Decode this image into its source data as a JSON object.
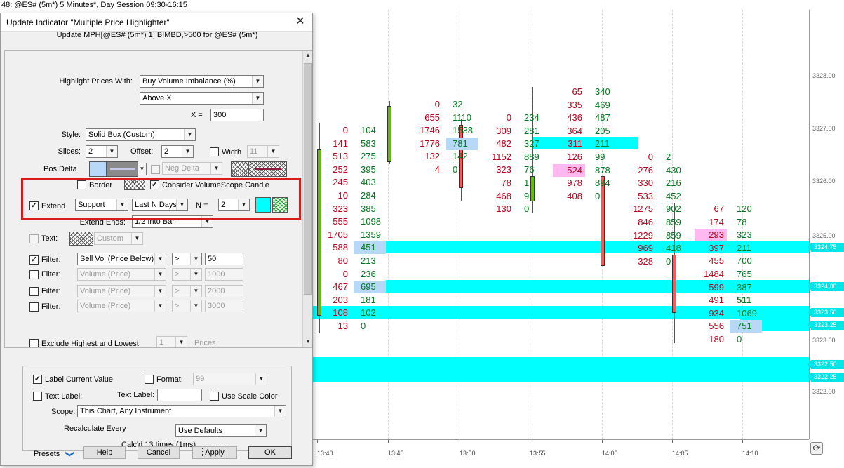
{
  "window": {
    "title": "48: @ES# (5m*) 5 Minutes*, Day Session 09:30-16:15"
  },
  "chart": {
    "price_ticks": [
      "3328.00",
      "3327.00",
      "3326.00",
      "3325.00",
      "3323.00",
      "3322.00"
    ],
    "price_labels": [
      "3324.75",
      "3324.00",
      "3323.50",
      "3323.25",
      "3322.50",
      "3322.25"
    ],
    "time_ticks": [
      "13:40",
      "13:45",
      "13:50",
      "13:55",
      "14:00",
      "14:05",
      "14:10"
    ],
    "refresh_glyph": "⟳",
    "colors": {
      "band": "#00ffff",
      "sell": "#c0001a",
      "buy": "#007a1e",
      "highlight_blue": "#b8d8f8",
      "highlight_pink": "#ffb8f0",
      "bull_candle": "#66bb00",
      "bear_candle": "#ff5555"
    },
    "columns": [
      {
        "rows": [
          [
            "0",
            "104"
          ],
          [
            "141",
            "583"
          ],
          [
            "513",
            "275"
          ],
          [
            "252",
            "395"
          ],
          [
            "245",
            "403"
          ],
          [
            "10",
            "284"
          ],
          [
            "323",
            "385"
          ],
          [
            "555",
            "1098"
          ],
          [
            "1705",
            "1359"
          ],
          [
            "588",
            "451"
          ],
          [
            "80",
            "213"
          ],
          [
            "0",
            "236"
          ],
          [
            "467",
            "695"
          ],
          [
            "203",
            "181"
          ],
          [
            "108",
            "102"
          ],
          [
            "13",
            "0"
          ]
        ]
      },
      {
        "rows": [
          [
            "0",
            "32"
          ],
          [
            "655",
            "1110"
          ],
          [
            "1746",
            "1538"
          ],
          [
            "1776",
            "781"
          ],
          [
            "132",
            "142"
          ],
          [
            "4",
            "0"
          ]
        ]
      },
      {
        "rows": [
          [
            "0",
            "234"
          ],
          [
            "309",
            "281"
          ],
          [
            "482",
            "327"
          ],
          [
            "1152",
            "889"
          ],
          [
            "323",
            "76"
          ],
          [
            "78",
            "1"
          ],
          [
            "468",
            "9"
          ],
          [
            "130",
            "0"
          ]
        ]
      },
      {
        "rows": [
          [
            "65",
            "340"
          ],
          [
            "335",
            "469"
          ],
          [
            "436",
            "487"
          ],
          [
            "364",
            "205"
          ],
          [
            "311",
            "211"
          ],
          [
            "126",
            "99"
          ],
          [
            "524",
            "878"
          ],
          [
            "978",
            "894"
          ],
          [
            "408",
            "0"
          ]
        ]
      },
      {
        "rows": [
          [
            "0",
            "2"
          ],
          [
            "276",
            "430"
          ],
          [
            "330",
            "216"
          ],
          [
            "533",
            "452"
          ],
          [
            "1275",
            "902"
          ],
          [
            "846",
            "859"
          ],
          [
            "1229",
            "859"
          ],
          [
            "969",
            "418"
          ],
          [
            "328",
            "0"
          ]
        ]
      },
      {
        "rows": [
          [
            "67",
            "120"
          ],
          [
            "174",
            "78"
          ],
          [
            "293",
            "323"
          ],
          [
            "397",
            "211"
          ],
          [
            "455",
            "700"
          ],
          [
            "1484",
            "765"
          ],
          [
            "599",
            "387"
          ],
          [
            "491",
            "511"
          ],
          [
            "934",
            "1069"
          ],
          [
            "556",
            "751"
          ],
          [
            "180",
            "0"
          ]
        ]
      }
    ]
  },
  "dialog": {
    "title": "Update Indicator \"Multiple Price Highlighter\"",
    "close_glyph": "✕",
    "subtitle": "Update MPH[@ES# (5m*) 1] BIMBD,>500 for @ES# (5m*)",
    "highlight_prices_with_label": "Highlight Prices With:",
    "highlight_prices_with_value": "Buy Volume Imbalance (%)",
    "condition_value": "Above X",
    "x_label": "X =",
    "x_value": "300",
    "style_label": "Style:",
    "style_value": "Solid Box (Custom)",
    "slices_label": "Slices:",
    "slices_value": "2",
    "offset_label": "Offset:",
    "offset_value": "2",
    "width_label": "Width",
    "width_value": "11",
    "pos_delta_label": "Pos Delta",
    "neg_delta_label": "Neg Delta",
    "border_label": "Border",
    "consider_label": "Consider VolumeScope Candle",
    "extend_label": "Extend",
    "extend_type_value": "Support",
    "extend_mode_value": "Last N Days",
    "n_label": "N =",
    "n_value": "2",
    "extend_ends_label": "Extend Ends:",
    "extend_ends_value": "1/2 Into Bar",
    "text_label": "Text:",
    "text_style_value": "Custom",
    "filter_label": "Filter:",
    "filters": [
      {
        "field": "Sell Vol (Price Below)",
        "op": ">",
        "value": "50"
      },
      {
        "field": "Volume (Price)",
        "op": ">",
        "value": "1000"
      },
      {
        "field": "Volume (Price)",
        "op": ">",
        "value": "2000"
      },
      {
        "field": "Volume (Price)",
        "op": ">",
        "value": "3000"
      }
    ],
    "exclude_label": "Exclude Highest and Lowest",
    "exclude_value": "1",
    "prices_label": "Prices",
    "label_current_label": "Label Current Value",
    "format_label": "Format:",
    "format_value": "99",
    "text_label_chk": "Text Label:",
    "text_label_field": "Text Label:",
    "use_scale_color_label": "Use Scale Color",
    "scope_label": "Scope:",
    "scope_value": "This Chart, Any Instrument",
    "recalc_label": "Recalculate Every",
    "recalc_value": "Use Defaults",
    "calcd_text": "Calc'd 13 times (1ms)",
    "presets_label": "Presets",
    "help_label": "Help",
    "cancel_label": "Cancel",
    "apply_label": "Apply",
    "ok_label": "OK",
    "check_glyph": "✓",
    "arrow_glyph": "▼",
    "up_glyph": "▲",
    "chevron_glyph": "❯"
  }
}
